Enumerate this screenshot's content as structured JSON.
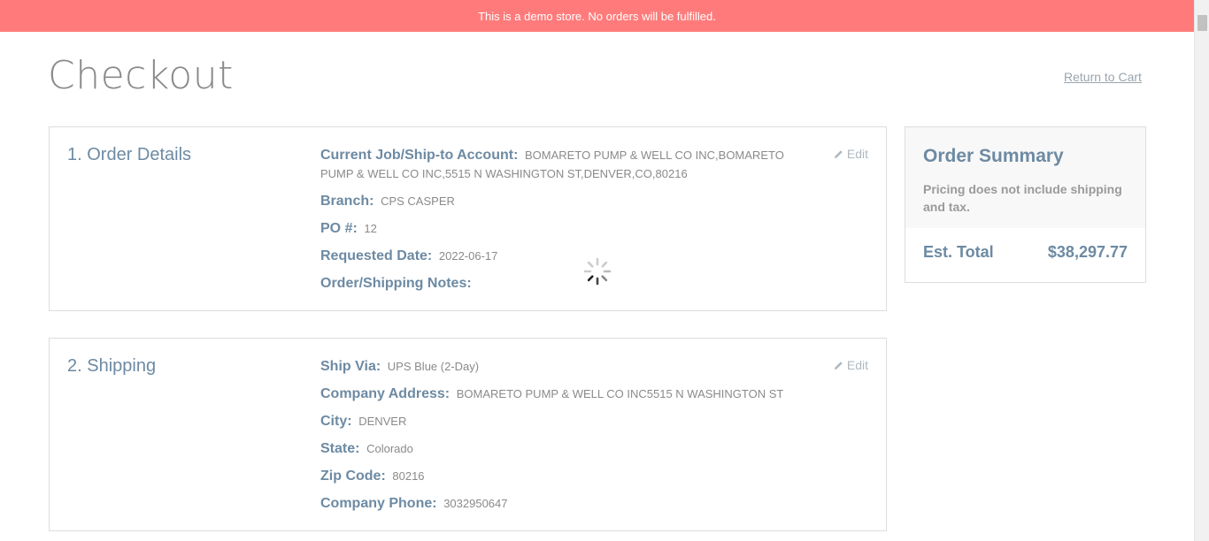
{
  "banner": {
    "text": "This is a demo store. No orders will be fulfilled."
  },
  "header": {
    "title": "Checkout",
    "return_link": "Return to Cart"
  },
  "order_details": {
    "heading": "1. Order Details",
    "edit_label": "Edit",
    "fields": [
      {
        "label": "Current Job/Ship-to Account:",
        "value": "BOMARETO PUMP & WELL CO INC,BOMARETO PUMP & WELL CO INC,5515 N WASHINGTON ST,DENVER,CO,80216"
      },
      {
        "label": "Branch:",
        "value": "CPS CASPER"
      },
      {
        "label": "PO #:",
        "value": "12"
      },
      {
        "label": "Requested Date:",
        "value": "2022-06-17"
      },
      {
        "label": "Order/Shipping Notes:",
        "value": ""
      }
    ]
  },
  "shipping": {
    "heading": "2. Shipping",
    "edit_label": "Edit",
    "fields": [
      {
        "label": "Ship Via:",
        "value": "UPS Blue (2-Day)"
      },
      {
        "label": "Company Address:",
        "value": "BOMARETO PUMP & WELL CO INC5515 N WASHINGTON ST"
      },
      {
        "label": "City:",
        "value": "DENVER"
      },
      {
        "label": "State:",
        "value": "Colorado"
      },
      {
        "label": "Zip Code:",
        "value": "80216"
      },
      {
        "label": "Company Phone:",
        "value": "3032950647"
      }
    ]
  },
  "summary": {
    "title": "Order Summary",
    "note": "Pricing does not include shipping and tax.",
    "total_label": "Est. Total",
    "total_value": "$38,297.77"
  },
  "icons": {
    "edit": "pencil-icon",
    "loading": "spinner-icon"
  },
  "colors": {
    "banner": "#ff7b7b",
    "heading": "#6d8aa3",
    "muted": "#8a8a8a"
  }
}
